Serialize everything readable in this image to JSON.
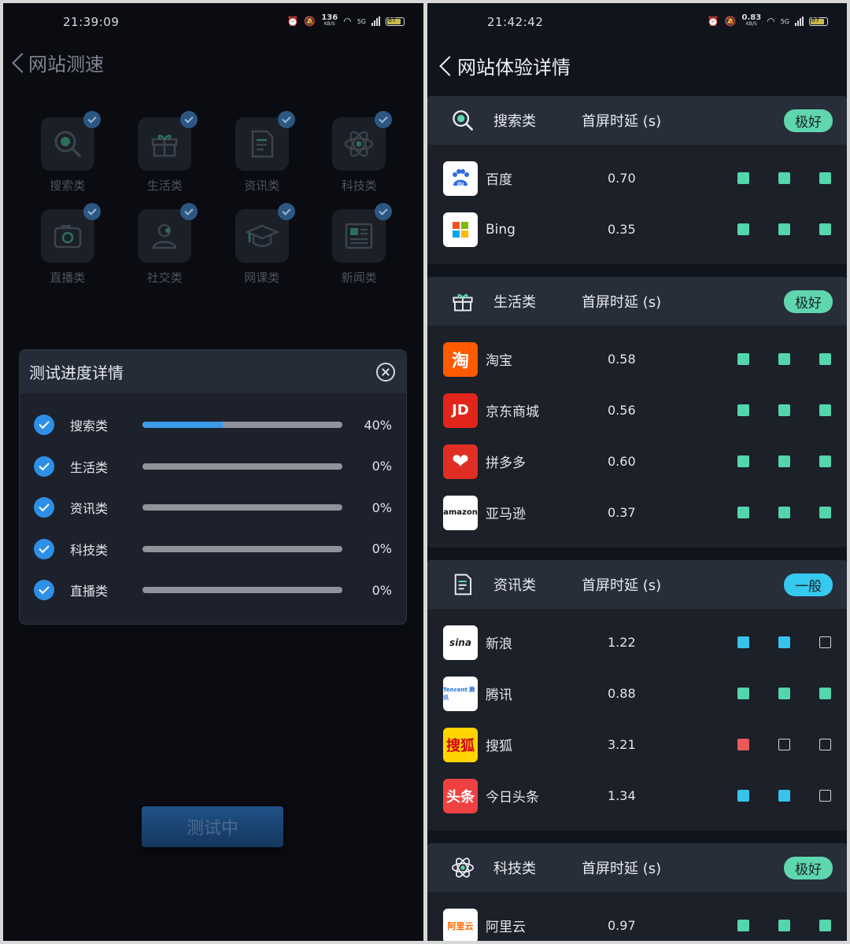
{
  "left": {
    "status": {
      "time": "21:39:09",
      "speed": "136",
      "speed_unit": "KB/S",
      "net": "5G",
      "battery": "87"
    },
    "title": "网站测速",
    "categories": [
      {
        "label": "搜索类",
        "icon": "search-icon"
      },
      {
        "label": "生活类",
        "icon": "gift-icon"
      },
      {
        "label": "资讯类",
        "icon": "document-icon"
      },
      {
        "label": "科技类",
        "icon": "atom-icon"
      },
      {
        "label": "直播类",
        "icon": "camera-icon"
      },
      {
        "label": "社交类",
        "icon": "user-icon"
      },
      {
        "label": "网课类",
        "icon": "graduation-cap-icon"
      },
      {
        "label": "新闻类",
        "icon": "newspaper-icon"
      }
    ],
    "modal": {
      "title": "测试进度详情",
      "items": [
        {
          "label": "搜索类",
          "percent_text": "40%",
          "progress": 0.4
        },
        {
          "label": "生活类",
          "percent_text": "0%",
          "progress": 0
        },
        {
          "label": "资讯类",
          "percent_text": "0%",
          "progress": 0
        },
        {
          "label": "科技类",
          "percent_text": "0%",
          "progress": 0
        },
        {
          "label": "直播类",
          "percent_text": "0%",
          "progress": 0
        }
      ]
    },
    "button_label": "测试中"
  },
  "right": {
    "status": {
      "time": "21:42:42",
      "speed": "0.83",
      "speed_unit": "KB/S",
      "net": "5G",
      "battery": "87"
    },
    "title": "网站体验详情",
    "metric_label": "首屏时延 (s)",
    "sections": [
      {
        "name": "搜索类",
        "icon": "search-icon",
        "badge": "极好",
        "badge_type": "great",
        "sites": [
          {
            "name": "百度",
            "value": "0.70",
            "logo": "du",
            "logo_bg": "#ffffff",
            "logo_color": "#2d6be0",
            "squares": [
              "g",
              "g",
              "g"
            ]
          },
          {
            "name": "Bing",
            "value": "0.35",
            "logo": "windows-logo",
            "logo_bg": "#ffffff",
            "logo_color": "#000000",
            "squares": [
              "g",
              "g",
              "g"
            ]
          }
        ]
      },
      {
        "name": "生活类",
        "icon": "gift-icon",
        "badge": "极好",
        "badge_type": "great",
        "sites": [
          {
            "name": "淘宝",
            "value": "0.58",
            "logo": "淘",
            "logo_bg": "#ff5a00",
            "logo_color": "#ffffff",
            "squares": [
              "g",
              "g",
              "g"
            ]
          },
          {
            "name": "京东商城",
            "value": "0.56",
            "logo": "JD",
            "logo_bg": "#e1251b",
            "logo_color": "#ffffff",
            "squares": [
              "g",
              "g",
              "g"
            ]
          },
          {
            "name": "拼多多",
            "value": "0.60",
            "logo": "heart-logo",
            "logo_bg": "#e02e24",
            "logo_color": "#ffffff",
            "squares": [
              "g",
              "g",
              "g"
            ]
          },
          {
            "name": "亚马逊",
            "value": "0.37",
            "logo": "amazon",
            "logo_bg": "#ffffff",
            "logo_color": "#111111",
            "squares": [
              "g",
              "g",
              "g"
            ]
          }
        ]
      },
      {
        "name": "资讯类",
        "icon": "document-icon",
        "badge": "一般",
        "badge_type": "normal",
        "sites": [
          {
            "name": "新浪",
            "value": "1.22",
            "logo": "sina",
            "logo_bg": "#ffffff",
            "logo_color": "#222222",
            "squares": [
              "b",
              "b",
              "e"
            ]
          },
          {
            "name": "腾讯",
            "value": "0.88",
            "logo": "Tencent 腾讯",
            "logo_bg": "#ffffff",
            "logo_color": "#1e6fd9",
            "squares": [
              "g",
              "g",
              "g"
            ]
          },
          {
            "name": "搜狐",
            "value": "3.21",
            "logo": "搜狐",
            "logo_bg": "#ffd400",
            "logo_color": "#d0021b",
            "squares": [
              "r",
              "e",
              "e"
            ]
          },
          {
            "name": "今日头条",
            "value": "1.34",
            "logo": "头条",
            "logo_bg": "#f04142",
            "logo_color": "#ffffff",
            "squares": [
              "b",
              "b",
              "e"
            ]
          }
        ]
      },
      {
        "name": "科技类",
        "icon": "atom-icon",
        "badge": "极好",
        "badge_type": "great",
        "sites": [
          {
            "name": "阿里云",
            "value": "0.97",
            "logo": "阿里云",
            "logo_bg": "#ffffff",
            "logo_color": "#ff6a00",
            "squares": [
              "g",
              "g",
              "g"
            ]
          }
        ]
      }
    ]
  }
}
